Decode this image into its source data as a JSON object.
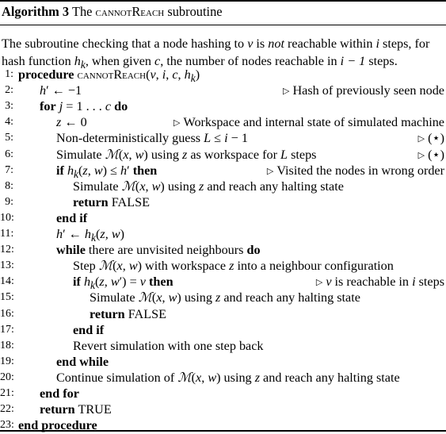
{
  "caption": {
    "label": "Algorithm 3",
    "pre": "The ",
    "name": "cannotReach",
    "post": " subroutine"
  },
  "description": {
    "p1": "The subroutine checking that a node hashing to ",
    "v": "v",
    "p2": " is ",
    "not": "not",
    "p3": " reachable within ",
    "i": "i",
    "p4": " steps, for hash function ",
    "hk": "h",
    "k": "k",
    "p5": ", when given ",
    "c": "c",
    "p6": ", the number of nodes reachable in ",
    "expr": "i − 1",
    "p7": " steps."
  },
  "lines": [
    {
      "n": "1:",
      "kw": "procedure",
      "text": "",
      "name": "cannotReach",
      "args": "(v, i, c, h",
      "sub": "k",
      "close": ")"
    },
    {
      "n": "2:",
      "text": "h′ ← −1",
      "comment": "Hash of previously seen node"
    },
    {
      "n": "3:",
      "kw": "for",
      "text": "j = 1 . . . c",
      "kw2": "do"
    },
    {
      "n": "4:",
      "text": "z ← 0",
      "comment": "Workspace and internal state of simulated machine"
    },
    {
      "n": "5:",
      "text": "Non-deterministically guess L ≤ i − 1",
      "comment": "(⋆)"
    },
    {
      "n": "6:",
      "text": "Simulate ℳ(x, w) using z as workspace for L steps",
      "comment": "(⋆)"
    },
    {
      "n": "7:",
      "kw": "if",
      "text": "h_k(z, w) ≤ h′",
      "kw2": "then",
      "comment": "Visited the nodes in wrong order"
    },
    {
      "n": "8:",
      "text": "Simulate ℳ(x, w) using z and reach any halting state"
    },
    {
      "n": "9:",
      "kw": "return",
      "text": "FALSE"
    },
    {
      "n": "10:",
      "kw": "end if",
      "text": ""
    },
    {
      "n": "11:",
      "text": "h′ ← h_k(z, w)"
    },
    {
      "n": "12:",
      "kw": "while",
      "text": "there are unvisited neighbours",
      "kw2": "do"
    },
    {
      "n": "13:",
      "text": "Step ℳ(x, w) with workspace z into a neighbour configuration"
    },
    {
      "n": "14:",
      "kw": "if",
      "text": "h_k(z, w′) = v",
      "kw2": "then",
      "comment": "v is reachable in i steps"
    },
    {
      "n": "15:",
      "text": "Simulate ℳ(x, w) using z and reach any halting state"
    },
    {
      "n": "16:",
      "kw": "return",
      "text": "FALSE"
    },
    {
      "n": "17:",
      "kw": "end if",
      "text": ""
    },
    {
      "n": "18:",
      "text": "Revert simulation with one step back"
    },
    {
      "n": "19:",
      "kw": "end while",
      "text": ""
    },
    {
      "n": "20:",
      "text": "Continue simulation of ℳ(x, w) using z and reach any halting state"
    },
    {
      "n": "21:",
      "kw": "end for",
      "text": ""
    },
    {
      "n": "22:",
      "kw": "return",
      "text": "TRUE"
    },
    {
      "n": "23:",
      "kw": "end procedure",
      "text": ""
    }
  ],
  "comment_marker": "▷"
}
